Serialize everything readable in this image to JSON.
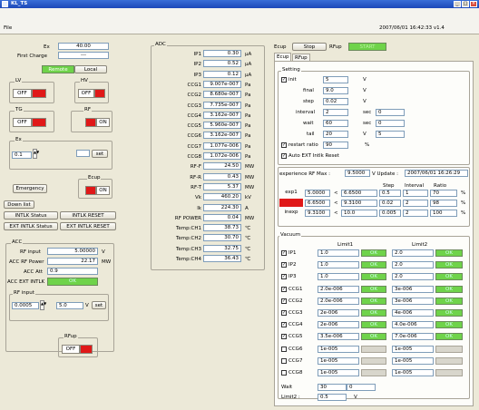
{
  "window": {
    "title": "KL_TS",
    "menu": "File",
    "datetime": "2007/06/01 16:42:33  v1.4",
    "min": "_",
    "max": "□",
    "close": "×"
  },
  "left": {
    "ex_label": "Ex",
    "ex_value": "40.00",
    "first_charge_label": "First Charge",
    "first_charge_value": "---",
    "remote": "Remote",
    "local": "Local",
    "lv": "LV",
    "hv": "HV",
    "tg": "TG",
    "rf": "RF",
    "off": "OFF",
    "on": "ON",
    "ex_set_label": "Ex",
    "ex_step": "0.1",
    "set": "set",
    "emergency": "Emergency",
    "ecup": "Ecup",
    "down_list": "Down list",
    "intlk_status": "INTLK Status",
    "intlk_reset": "INTLK RESET",
    "ext_intlk_status": "EXT INTLK Status",
    "ext_intlk_reset": "EXT INTLK RESET",
    "acc_label": "ACC",
    "rf_input_label": "RF input",
    "rf_input_value": "5.00000",
    "rf_input_unit": "V",
    "acc_rf_power_label": "ACC RF Power",
    "acc_rf_power_value": "22.17",
    "acc_rf_power_unit": "MW",
    "acc_att_label": "ACC Att",
    "acc_att_value": "0.9",
    "acc_ext_intlk_label": "ACC EXT INTLK",
    "ok": "OK",
    "rf_input_group": "RF input",
    "rf_step": "0.0005",
    "rf_set_value": "5.0",
    "v": "V",
    "rfup": "RFup"
  },
  "adc": {
    "title": "ADC",
    "rows": [
      {
        "name": "IP1",
        "value": "0.30",
        "unit": "μA"
      },
      {
        "name": "IP2",
        "value": "0.52",
        "unit": "μA"
      },
      {
        "name": "IP3",
        "value": "0.12",
        "unit": "μA"
      },
      {
        "name": "CCG1",
        "value": "9.007e-007",
        "unit": "Pa"
      },
      {
        "name": "CCG2",
        "value": "8.680e-007",
        "unit": "Pa"
      },
      {
        "name": "CCG3",
        "value": "7.735e-007",
        "unit": "Pa"
      },
      {
        "name": "CCG4",
        "value": "3.162e-007",
        "unit": "Pa"
      },
      {
        "name": "CCG5",
        "value": "5.960e-007",
        "unit": "Pa"
      },
      {
        "name": "CCG6",
        "value": "3.162e-007",
        "unit": "Pa"
      },
      {
        "name": "CCG7",
        "value": "1.077e-006",
        "unit": "Pa"
      },
      {
        "name": "CCG8",
        "value": "1.072e-006",
        "unit": "Pa"
      },
      {
        "name": "RF-F",
        "value": "24.50",
        "unit": "MW"
      },
      {
        "name": "RF-R",
        "value": "0.43",
        "unit": "MW"
      },
      {
        "name": "RF-T",
        "value": "5.37",
        "unit": "MW"
      },
      {
        "name": "Vk",
        "value": "460.20",
        "unit": "kV"
      },
      {
        "name": "Ik",
        "value": "224.30",
        "unit": "A"
      },
      {
        "name": "RF POWER",
        "value": "0.04",
        "unit": "MW"
      },
      {
        "name": "Temp:CH1",
        "value": "38.73",
        "unit": "℃"
      },
      {
        "name": "Temp:CH2",
        "value": "30.70",
        "unit": "℃"
      },
      {
        "name": "Temp:CH3",
        "value": "32.75",
        "unit": "℃"
      },
      {
        "name": "Temp:CH4",
        "value": "36.43",
        "unit": "℃"
      }
    ]
  },
  "right": {
    "ecup_label": "Ecup",
    "stop": "Stop",
    "rfup_label": "RFup",
    "start": "START",
    "tabs": [
      "Ecup",
      "RFup"
    ],
    "setting": "Setting",
    "init": "init",
    "init_value": "5",
    "final": "final",
    "final_value": "9.0",
    "step": "step",
    "step_value": "0.02",
    "interval": "interval",
    "interval_value": "2",
    "interval_sec": "0",
    "wait": "wait",
    "wait_value": "60",
    "wait_sec": "0",
    "tail": "tail",
    "tail_value": "20",
    "tail_sec": "5",
    "restart_ratio": "restart ratio",
    "restart_value": "90",
    "pct": "%",
    "sec": "sec",
    "v": "V",
    "auto_ext": "Auto EXT Intlk Reset",
    "exp_rf_max_label": "experience RF Max :",
    "exp_rf_max_value": "9.5000",
    "update_label": "V Update :",
    "update_value": "2007/06/01 16:26:29",
    "seq_head": {
      "step": "Step",
      "interval": "Interval",
      "ratio": "Ratio"
    },
    "seq": [
      {
        "name": "exp1",
        "a": "5.0000",
        "b": "6.6500",
        "step": "0.5",
        "interval": "1",
        "ratio": "70"
      },
      {
        "name": "exp2",
        "a": "6.6500",
        "b": "9.3100",
        "step": "0.02",
        "interval": "2",
        "ratio": "98"
      },
      {
        "name": "inexp",
        "a": "9.3100",
        "b": "10.0",
        "step": "0.005",
        "interval": "2",
        "ratio": "100"
      }
    ],
    "lt": "<",
    "vacuum": "Vacuum",
    "limit1": "Limit1",
    "limit2": "Limit2",
    "vac": [
      {
        "name": "IP1",
        "l1": "1.0",
        "l2": "2.0",
        "c": true,
        "ok": true
      },
      {
        "name": "IP2",
        "l1": "1.0",
        "l2": "2.0",
        "c": true,
        "ok": true
      },
      {
        "name": "IP3",
        "l1": "1.0",
        "l2": "2.0",
        "c": true,
        "ok": true
      },
      {
        "name": "CCG1",
        "l1": "2.0e-006",
        "l2": "3e-006",
        "c": true,
        "ok": true
      },
      {
        "name": "CCG2",
        "l1": "2.0e-006",
        "l2": "3e-006",
        "c": true,
        "ok": true
      },
      {
        "name": "CCG3",
        "l1": "2e-006",
        "l2": "4e-006",
        "c": true,
        "ok": true
      },
      {
        "name": "CCG4",
        "l1": "2e-006",
        "l2": "4.0e-006",
        "c": true,
        "ok": true
      },
      {
        "name": "CCG5",
        "l1": "3.5e-006",
        "l2": "7.0e-006",
        "c": true,
        "ok": true
      },
      {
        "name": "CCG6",
        "l1": "1e-005",
        "l2": "1e-005",
        "c": false,
        "ok": false
      },
      {
        "name": "CCG7",
        "l1": "1e-005",
        "l2": "1e-005",
        "c": false,
        "ok": false
      },
      {
        "name": "CCG8",
        "l1": "1e-005",
        "l2": "1e-005",
        "c": false,
        "ok": false
      }
    ],
    "wait2_label": "Wait",
    "wait2_value": "30",
    "wait2_b": "0",
    "limit2_label": "Limit2 :",
    "limit2_value": "0.5",
    "limit2_unit": "V"
  },
  "colors": {
    "ok": "#6fd34a",
    "alarm": "#e01818",
    "title": "#1c48b8"
  }
}
